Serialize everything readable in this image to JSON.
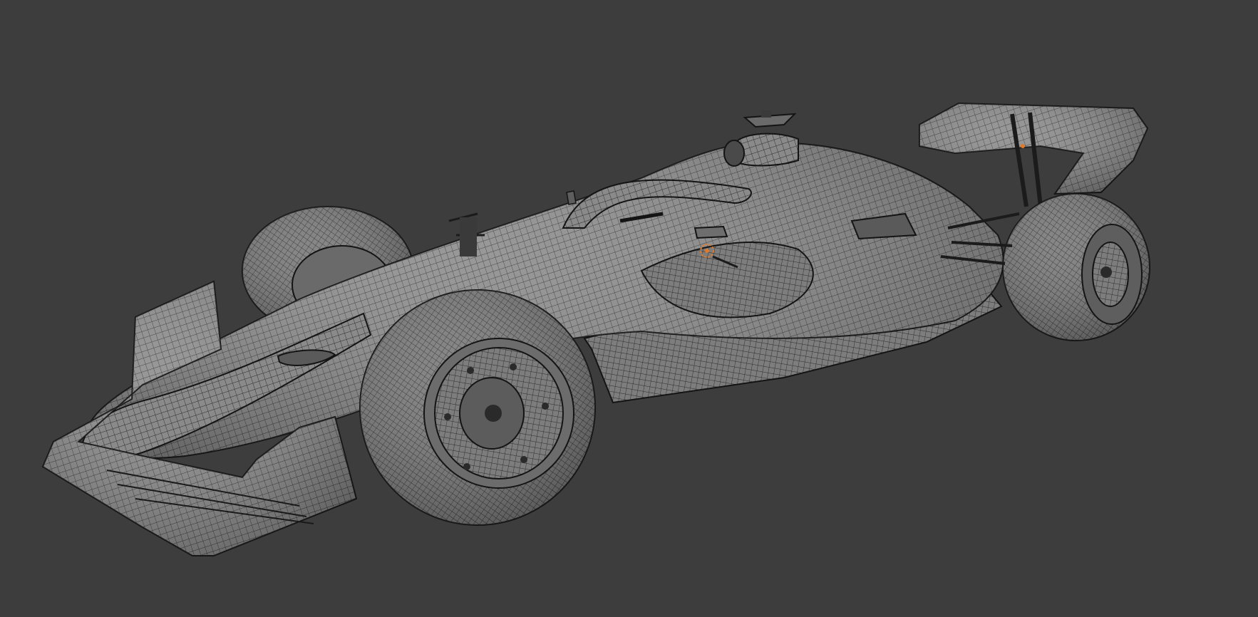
{
  "viewport": {
    "background": "#3d3d3d",
    "shading": "solid",
    "overlay": "wireframe"
  },
  "model": {
    "subject": "formula-1-car",
    "body_color": "#8a8a8a",
    "wire_color": "#2a2a2a",
    "edge_color": "#141414",
    "origin_color": "#e07a2a"
  },
  "scene_objects": [
    "front-wing",
    "nose-cone",
    "chassis",
    "halo",
    "airbox",
    "sidepod",
    "floor",
    "front-left-wheel",
    "front-right-wheel",
    "rear-right-wheel",
    "rear-wing",
    "mirror",
    "suspension"
  ],
  "cursor_3d": {
    "icon": "3d-cursor-icon",
    "color": "#e07a2a"
  }
}
